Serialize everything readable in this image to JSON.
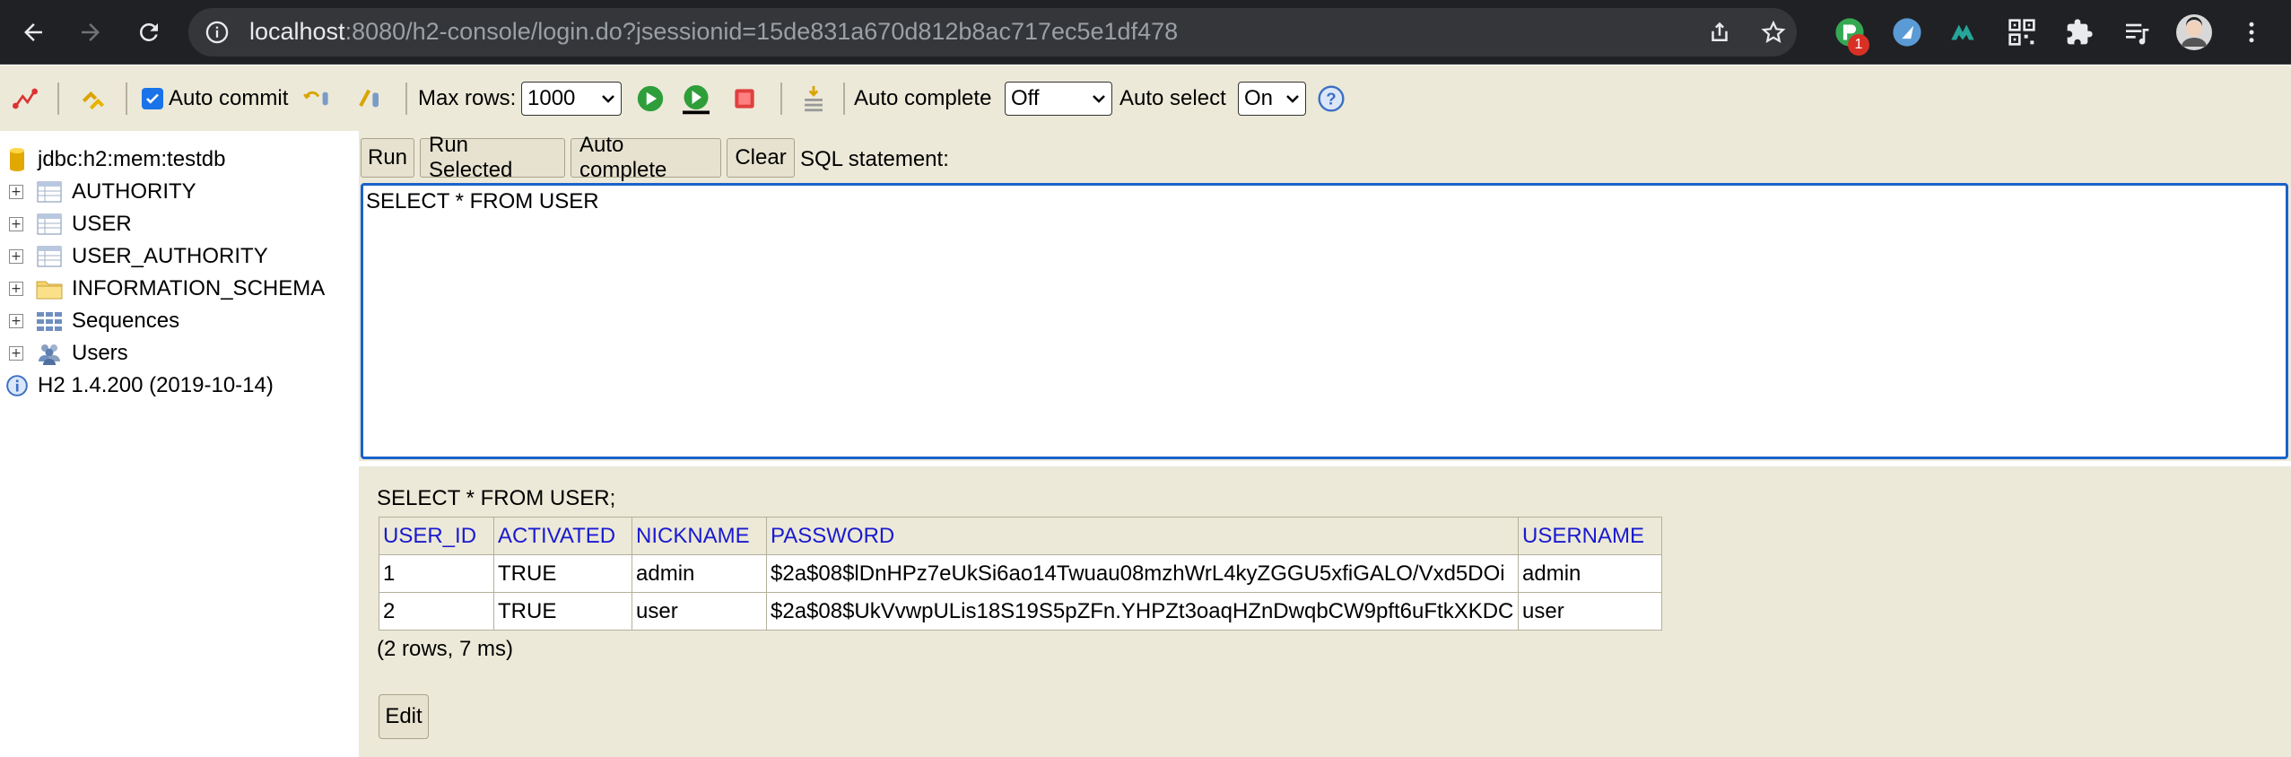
{
  "browser": {
    "url_host": "localhost",
    "url_rest": ":8080/h2-console/login.do?jsessionid=15de831a670d812b8ac717ec5e1df478",
    "extension_badge": "1",
    "icons": [
      "back-arrow-icon",
      "forward-arrow-icon",
      "reload-icon",
      "info-icon",
      "share-icon",
      "star-icon",
      "extension-icon",
      "extension-icon",
      "extension-icon",
      "qr-icon",
      "puzzle-icon",
      "reading-list-icon",
      "avatar",
      "kebab-menu-icon"
    ]
  },
  "toolbar": {
    "auto_commit_label": "Auto commit",
    "auto_commit_checked": true,
    "max_rows_label": "Max rows:",
    "max_rows_value": "1000",
    "auto_complete_label": "Auto complete",
    "auto_complete_value": "Off",
    "auto_select_label": "Auto select",
    "auto_select_value": "On",
    "help_glyph": "?"
  },
  "tree": {
    "connection": "jdbc:h2:mem:testdb",
    "items": [
      {
        "label": "AUTHORITY",
        "icon": "table-icon"
      },
      {
        "label": "USER",
        "icon": "table-icon"
      },
      {
        "label": "USER_AUTHORITY",
        "icon": "table-icon"
      },
      {
        "label": "INFORMATION_SCHEMA",
        "icon": "folder-icon"
      },
      {
        "label": "Sequences",
        "icon": "sequence-icon"
      },
      {
        "label": "Users",
        "icon": "users-icon"
      }
    ],
    "version": "H2 1.4.200 (2019-10-14)"
  },
  "query": {
    "buttons": {
      "run": "Run",
      "run_selected": "Run Selected",
      "auto_complete": "Auto complete",
      "clear": "Clear"
    },
    "sql_label": "SQL statement:",
    "sql_text": "SELECT * FROM USER"
  },
  "result": {
    "query": "SELECT * FROM USER;",
    "columns": [
      "USER_ID",
      "ACTIVATED",
      "NICKNAME",
      "PASSWORD",
      "USERNAME"
    ],
    "rows": [
      [
        "1",
        "TRUE",
        "admin",
        "$2a$08$lDnHPz7eUkSi6ao14Twuau08mzhWrL4kyZGGU5xfiGALO/Vxd5DOi",
        "admin"
      ],
      [
        "2",
        "TRUE",
        "user",
        "$2a$08$UkVvwpULis18S19S5pZFn.YHPZt3oaqHZnDwqbCW9pft6uFtkXKDC",
        "user"
      ]
    ],
    "summary": "(2 rows, 7 ms)",
    "edit_label": "Edit"
  }
}
